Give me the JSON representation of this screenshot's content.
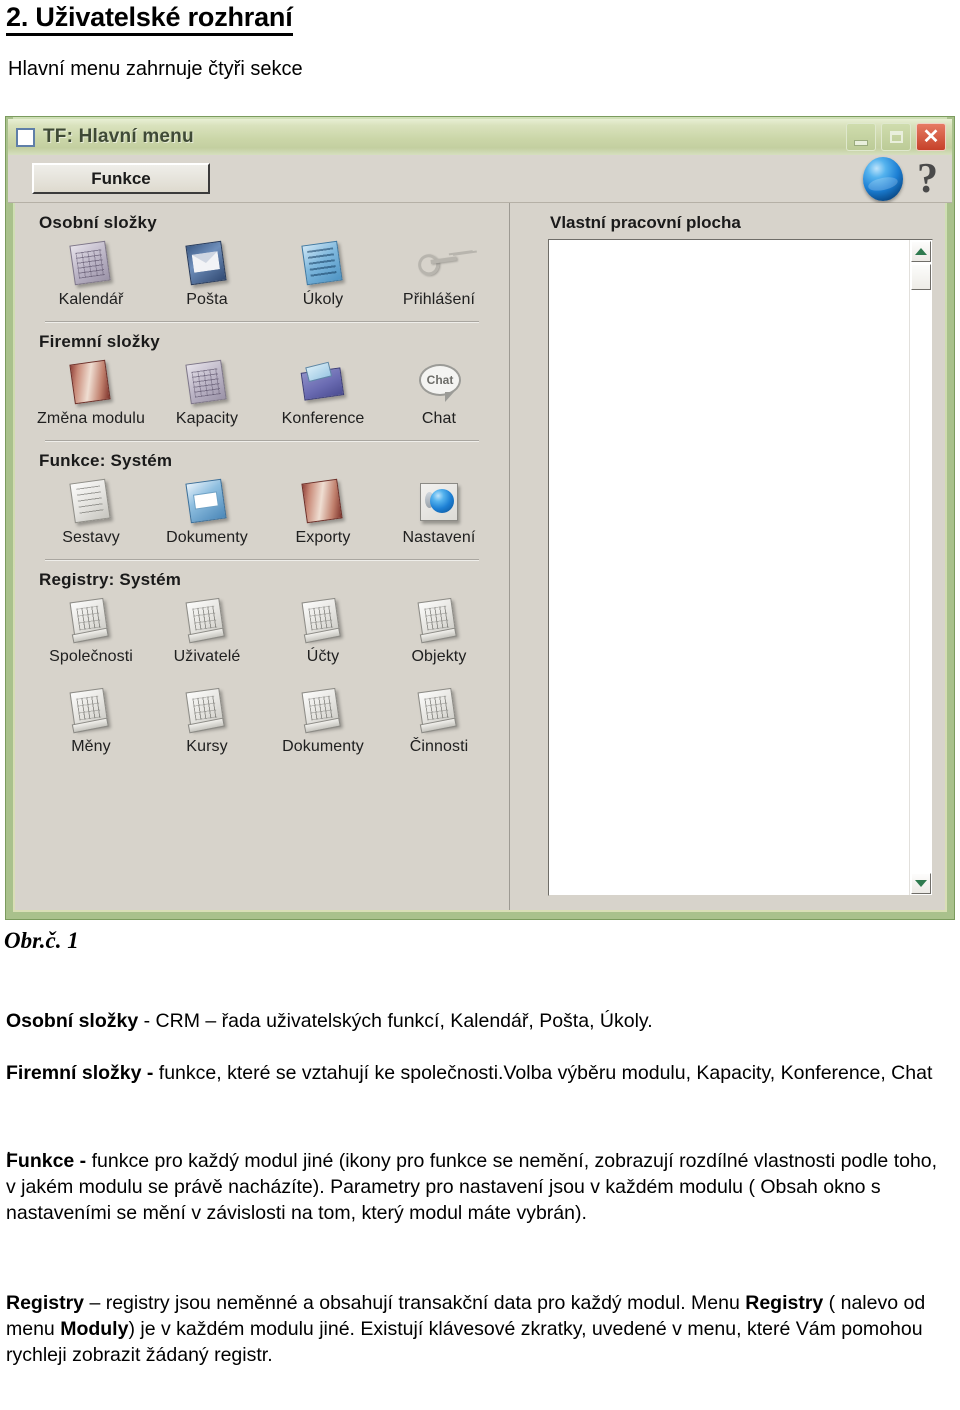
{
  "document": {
    "heading": "2. Uživatelské rozhraní",
    "subheading": "Hlavní menu zahrnuje čtyři sekce",
    "caption": "Obr.č. 1"
  },
  "window": {
    "title": "TF: Hlavní menu",
    "icons": {
      "titlebar_icon": "window-icon",
      "minimize": "minimize-icon",
      "maximize": "maximize-icon",
      "close": "close-icon",
      "globe": "globe-icon",
      "help": "help-icon"
    },
    "help_glyph": "?",
    "toolbar": {
      "funkce_label": "Funkce"
    }
  },
  "sections": [
    {
      "title": "Osobní složky",
      "items": [
        {
          "label": "Kalendář",
          "icon": "calendar-icon"
        },
        {
          "label": "Pošta",
          "icon": "mail-icon"
        },
        {
          "label": "Úkoly",
          "icon": "tasks-icon"
        },
        {
          "label": "Přihlášení",
          "icon": "keys-icon"
        }
      ]
    },
    {
      "title": "Firemní složky",
      "items": [
        {
          "label": "Změna modulu",
          "icon": "book-icon"
        },
        {
          "label": "Kapacity",
          "icon": "calendar-icon"
        },
        {
          "label": "Konference",
          "icon": "folder-icon"
        },
        {
          "label": "Chat",
          "icon": "chat-bubble-icon"
        }
      ]
    },
    {
      "title": "Funkce: Systém",
      "items": [
        {
          "label": "Sestavy",
          "icon": "report-icon"
        },
        {
          "label": "Dokumenty",
          "icon": "documents-icon"
        },
        {
          "label": "Exporty",
          "icon": "book-icon"
        },
        {
          "label": "Nastavení",
          "icon": "settings-globe-icon"
        }
      ]
    },
    {
      "title": "Registry: Systém",
      "items": [
        {
          "label": "Společnosti",
          "icon": "scroll-icon"
        },
        {
          "label": "Uživatelé",
          "icon": "scroll-icon"
        },
        {
          "label": "Účty",
          "icon": "scroll-icon"
        },
        {
          "label": "Objekty",
          "icon": "scroll-icon"
        },
        {
          "label": "Měny",
          "icon": "scroll-icon"
        },
        {
          "label": "Kursy",
          "icon": "scroll-icon"
        },
        {
          "label": "Dokumenty",
          "icon": "scroll-icon"
        },
        {
          "label": "Činnosti",
          "icon": "scroll-icon"
        }
      ]
    }
  ],
  "workspace": {
    "title": "Vlastní pracovní plocha",
    "content": "",
    "scrollbar": {
      "up_icon": "scroll-up-arrow-icon",
      "down_icon": "scroll-down-arrow-icon"
    }
  },
  "paragraphs": {
    "p1_bold": "Osobní složky",
    "p1_rest": " - CRM – řada uživatelských funkcí, Kalendář, Pošta, Úkoly.",
    "p2_bold": "Firemní složky -",
    "p2_rest": "  funkce, které se vztahují ke společnosti.Volba výběru modulu, Kapacity, Konference, Chat",
    "p3": ".",
    "p4_bold": "Funkce -",
    "p4_rest": " funkce pro každý modul jiné  (ikony pro funkce se nemění, zobrazují rozdílné vlastnosti podle toho, v jakém modulu se právě nacházíte). Parametry pro nastavení jsou v každém modulu ( Obsah okno s nastaveními se mění v závislosti na tom, který modul máte vybrán).",
    "p5_a_bold": "Registry",
    "p5_a_rest": " – registry jsou  neměnné a obsahují transakční data pro každý modul. Menu ",
    "p5_b_bold": "Registry",
    "p5_b_rest": " ( nalevo od menu ",
    "p5_c_bold": "Moduly",
    "p5_c_rest": ") je v každém modulu jiné. Existují klávesové zkratky, uvedené v menu, které Vám pomohou rychleji zobrazit žádaný registr."
  },
  "colors": {
    "titlebar_green": "#cbd6a8",
    "window_frame_green": "#a9c18c",
    "dialog_gray": "#d7d3cb",
    "close_red": "#c6412a",
    "scroll_arrow_green": "#2f7a4f"
  }
}
